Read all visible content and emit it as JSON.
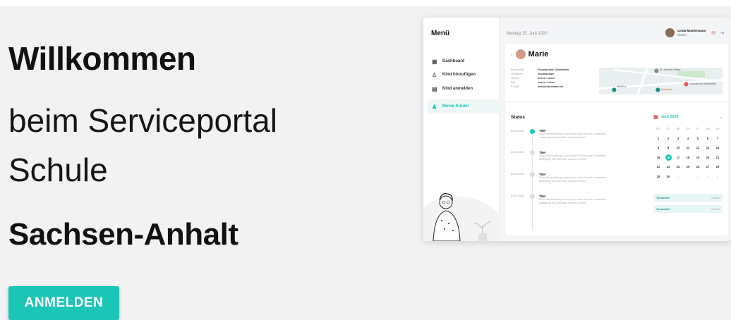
{
  "hero": {
    "title": "Willkommen",
    "subtitle_line1": "beim Serviceportal",
    "subtitle_line2": "Schule",
    "state": "Sachsen-Anhalt",
    "login_button": "ANMELDEN"
  },
  "mockup": {
    "menu_title": "Menü",
    "sidebar": [
      {
        "label": "Dashboard",
        "icon": "dashboard-icon"
      },
      {
        "label": "Kind hinzufügen",
        "icon": "add-user-icon"
      },
      {
        "label": "Kind anmelden",
        "icon": "briefcase-icon"
      },
      {
        "label": "Meine Kinder",
        "icon": "users-icon",
        "active": true
      }
    ],
    "date": "Montag 15. Juni 2020",
    "user": {
      "name": "Linda Mustermann",
      "role": "Mutter"
    },
    "child": {
      "name": "Marie",
      "info": [
        {
          "key": "Schulname",
          "value": "Grundschule Oberleiben"
        },
        {
          "key": "Schulform",
          "value": "Grundschule"
        },
        {
          "key": "Telefon",
          "value": "xxxxx / xxxxx"
        },
        {
          "key": "Fax",
          "value": "xxxxx / xxxxx"
        },
        {
          "key": "E-Mail",
          "value": "info@schulname.de"
        }
      ]
    },
    "status_title": "Status",
    "timeline": [
      {
        "date": "01.06.2020",
        "title": "Titel",
        "desc1": "Kurze Beschreibung Lorem ipsum dolor sit amet, consetetur",
        "desc2": "sadipscing elitr, sed diam nonumy eirmod",
        "active": true
      },
      {
        "date": "01.06.2020",
        "title": "Titel",
        "desc1": "Kurze Beschreibung Lorem ipsum dolor sit amet, consetetur",
        "desc2": "sadipscing elitr, sed diam nonumy eirmod",
        "active": false
      },
      {
        "date": "01.06.2020",
        "title": "Titel",
        "desc1": "Kurze Beschreibung Lorem ipsum dolor sit amet, consetetur",
        "desc2": "sadipscing elitr, sed diam nonumy eirmod",
        "active": false
      },
      {
        "date": "01.06.2020",
        "title": "Titel",
        "desc1": "Kurze Beschreibung Lorem ipsum dolor sit amet, consetetur",
        "desc2": "sadipscing elitr, sed diam nonumy eirmod",
        "active": false
      }
    ],
    "calendar": {
      "month": "Juni 2020",
      "weekdays": [
        "Mo",
        "Di",
        "Mi",
        "Do",
        "Fr",
        "Sa",
        "So"
      ],
      "days": [
        "1",
        "2",
        "3",
        "4",
        "5",
        "6",
        "7",
        "8",
        "9",
        "10",
        "11",
        "12",
        "13",
        "14",
        "15",
        "16",
        "17",
        "18",
        "19",
        "20",
        "21",
        "22",
        "23",
        "24",
        "25",
        "26",
        "27",
        "28",
        "29",
        "30",
        "1",
        "2",
        "3",
        "4",
        "5"
      ],
      "selected": "16"
    },
    "appointments": [
      {
        "name": "Termintitel",
        "link": "Details"
      },
      {
        "name": "Termintitel",
        "link": "Details"
      }
    ],
    "map_labels": [
      "Dr. Joachim Weber",
      "Grundschule Oberleiben",
      "Bahnhof",
      "Marktplatz"
    ]
  },
  "colors": {
    "accent": "#1cc6b6",
    "background": "#f2f2f2",
    "alert": "#e05a5a"
  }
}
